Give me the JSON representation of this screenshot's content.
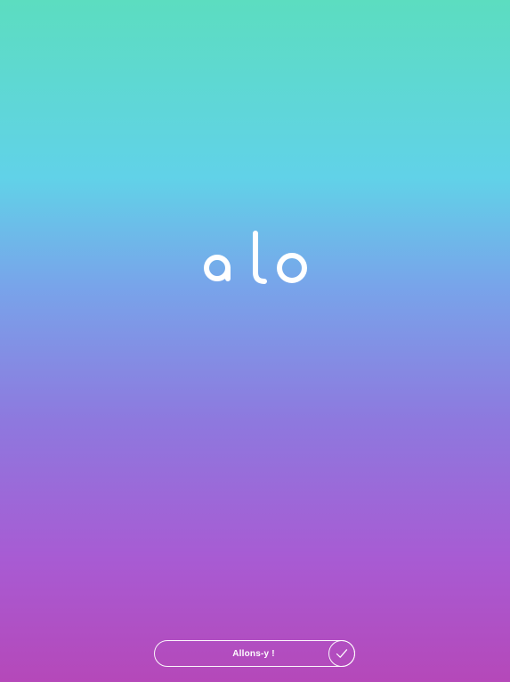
{
  "app": {
    "logo": "alo"
  },
  "cta": {
    "label": "Allons-y !"
  },
  "icons": {
    "confirm": "check-icon"
  },
  "colors": {
    "gradient_top": "#5cddc0",
    "gradient_mid": "#78a4ea",
    "gradient_bottom": "#b548b9",
    "foreground": "#ffffff"
  }
}
